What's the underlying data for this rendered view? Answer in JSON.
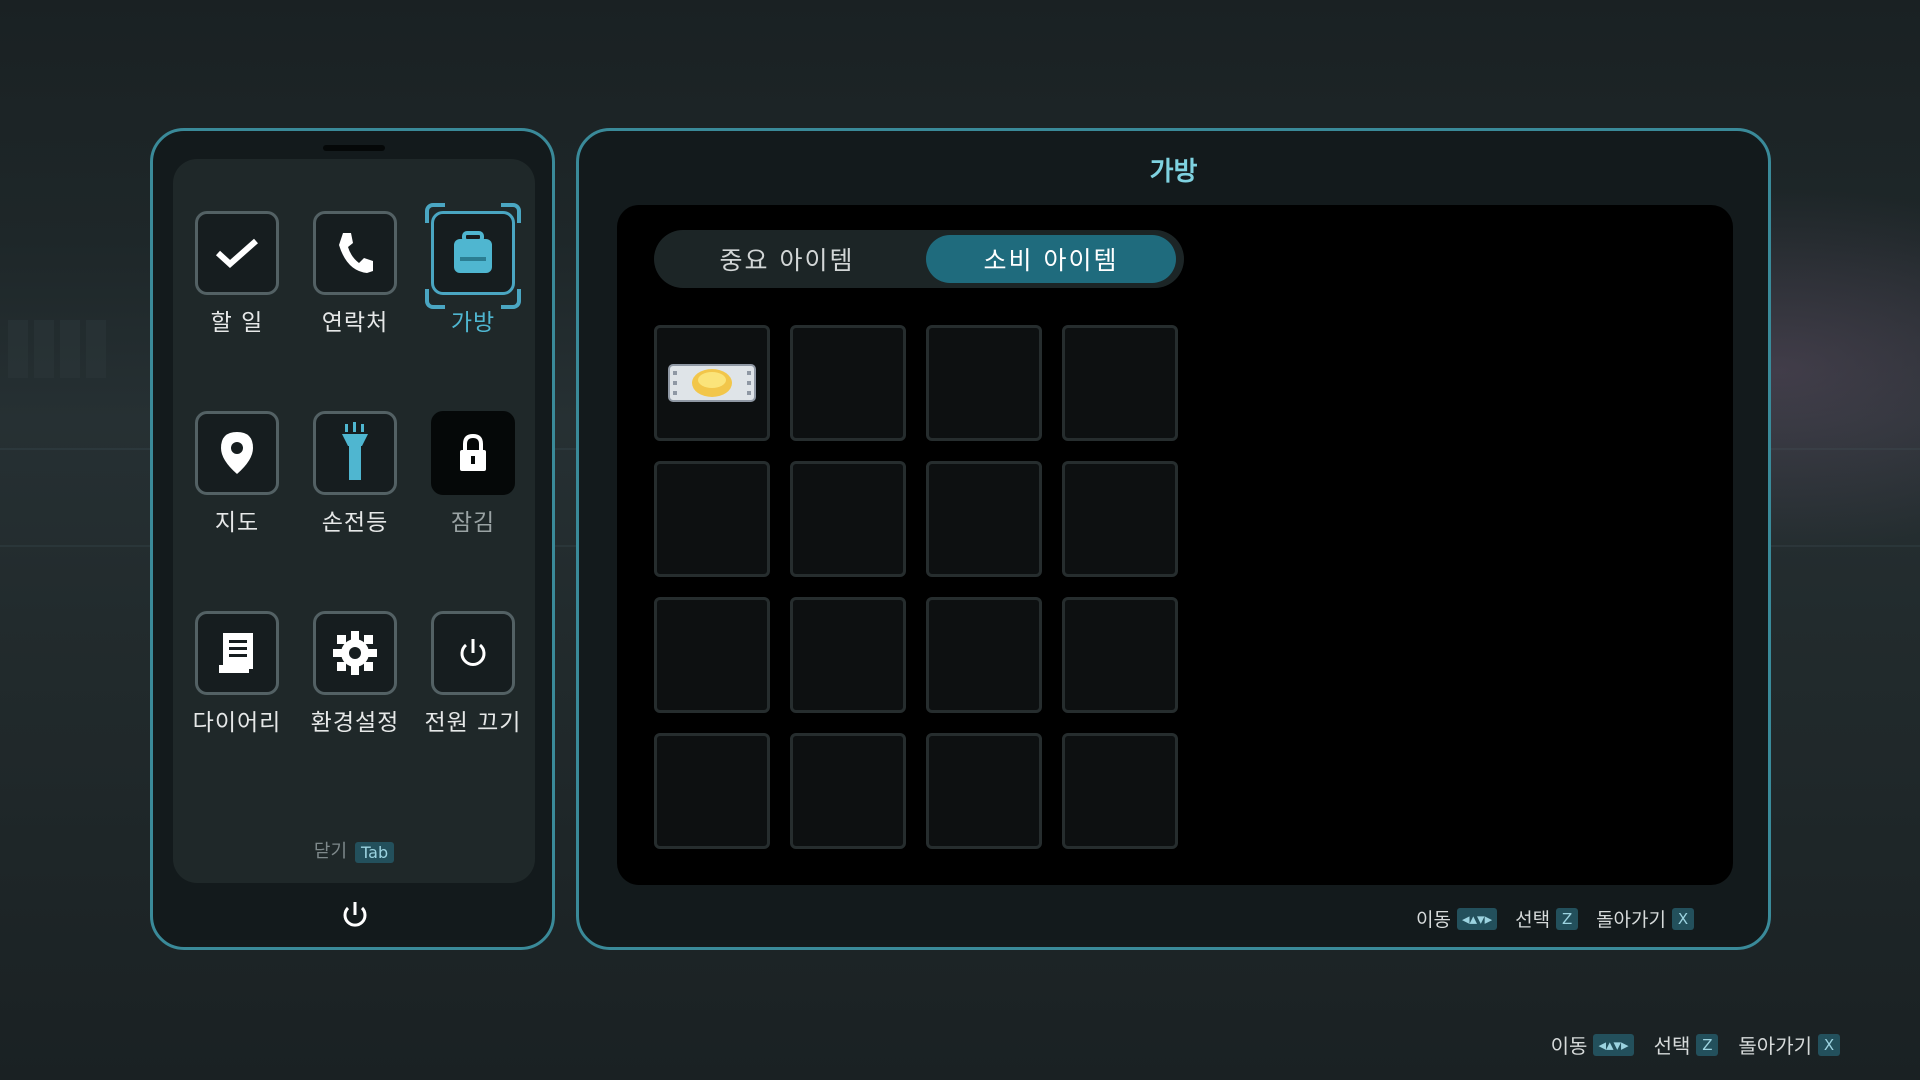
{
  "phone": {
    "apps": [
      {
        "label": "할 일",
        "icon": "checkmark-icon"
      },
      {
        "label": "연락처",
        "icon": "phone-icon"
      },
      {
        "label": "가방",
        "icon": "backpack-icon",
        "selected": true
      },
      {
        "label": "지도",
        "icon": "map-pin-icon"
      },
      {
        "label": "손전등",
        "icon": "flashlight-icon"
      },
      {
        "label": "잠김",
        "icon": "lock-icon",
        "locked": true
      },
      {
        "label": "다이어리",
        "icon": "diary-icon"
      },
      {
        "label": "환경설정",
        "icon": "gear-icon"
      },
      {
        "label": "전원 끄기",
        "icon": "power-icon"
      }
    ],
    "close_label": "닫기",
    "close_key": "Tab"
  },
  "bag": {
    "title": "가방",
    "tabs": [
      {
        "label": "중요 아이템",
        "active": false
      },
      {
        "label": "소비 아이템",
        "active": true
      }
    ],
    "slots": [
      {
        "item": "pill-pack-icon"
      },
      {},
      {},
      {},
      {},
      {},
      {},
      {},
      {},
      {},
      {},
      {},
      {},
      {},
      {},
      {}
    ],
    "hints": [
      {
        "label": "이동",
        "key": "◂▴▾▸"
      },
      {
        "label": "선택",
        "key": "Z"
      },
      {
        "label": "돌아가기",
        "key": "X"
      }
    ]
  },
  "screen_hints": [
    {
      "label": "이동",
      "key": "◂▴▾▸"
    },
    {
      "label": "선택",
      "key": "Z"
    },
    {
      "label": "돌아가기",
      "key": "X"
    }
  ],
  "colors": {
    "accent": "#3a8a99",
    "active_tab": "#1f6b7d",
    "active_label": "#4fb6d0",
    "key_badge": "#23505c"
  }
}
